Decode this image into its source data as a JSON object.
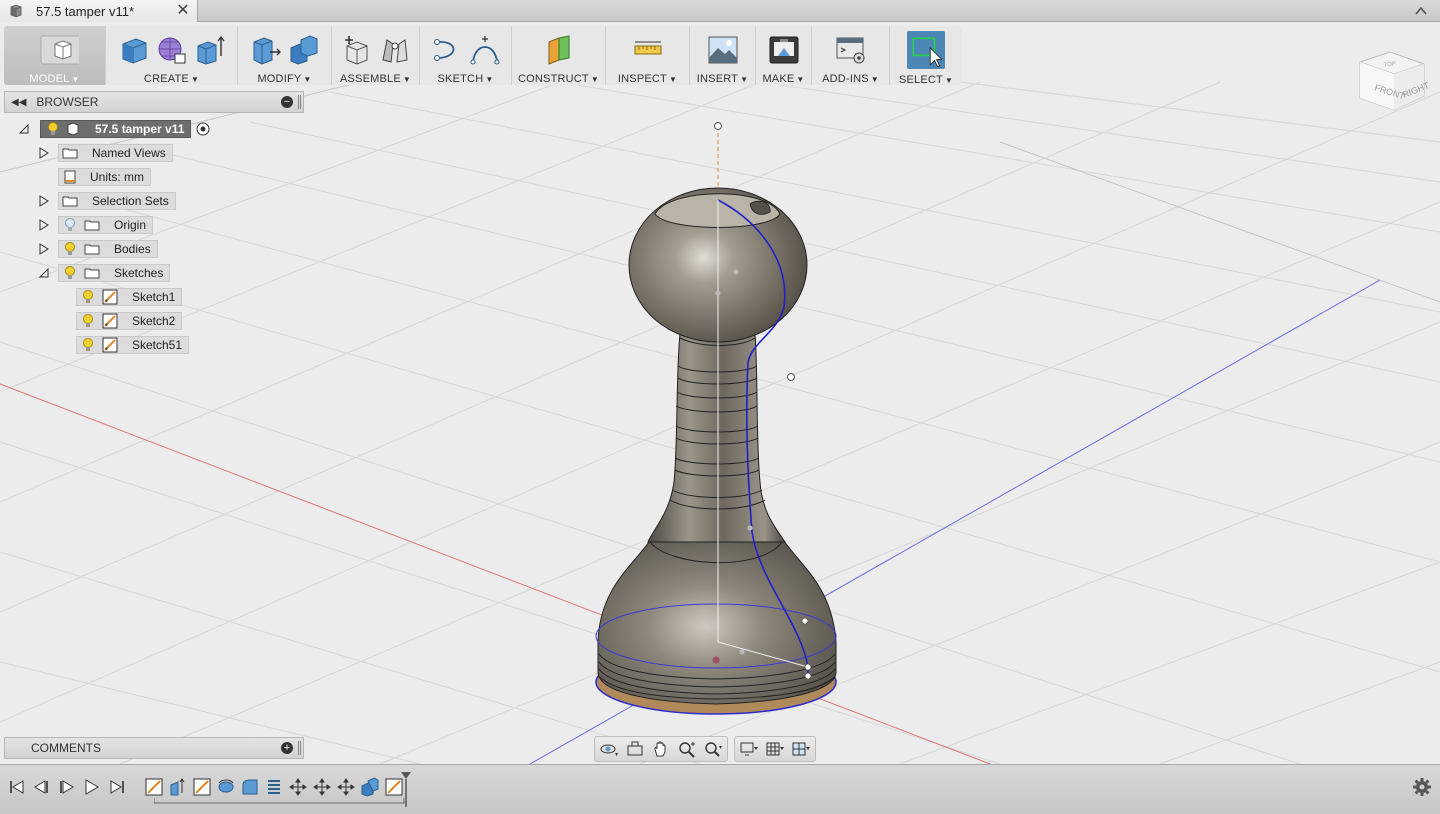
{
  "document": {
    "title": "57.5 tamper v11*",
    "close_glyph": "✕"
  },
  "toolbar": {
    "groups": [
      {
        "id": "model",
        "label": "MODEL",
        "icon": "model-workspace-icon"
      },
      {
        "id": "create",
        "label": "CREATE",
        "icon": "create-box-icon"
      },
      {
        "id": "modify",
        "label": "MODIFY",
        "icon": "press-pull-icon"
      },
      {
        "id": "assemble",
        "label": "ASSEMBLE",
        "icon": "new-component-icon"
      },
      {
        "id": "sketch",
        "label": "SKETCH",
        "icon": "sketch-icon"
      },
      {
        "id": "construct",
        "label": "CONSTRUCT",
        "icon": "plane-icon"
      },
      {
        "id": "inspect",
        "label": "INSPECT",
        "icon": "measure-icon"
      },
      {
        "id": "insert",
        "label": "INSERT",
        "icon": "insert-image-icon"
      },
      {
        "id": "make",
        "label": "MAKE",
        "icon": "3d-print-icon"
      },
      {
        "id": "addins",
        "label": "ADD-INS",
        "icon": "scripts-icon"
      },
      {
        "id": "select",
        "label": "SELECT",
        "icon": "select-window-icon"
      }
    ]
  },
  "viewcube": {
    "top": "TOP",
    "front": "FRONT",
    "right": "RIGHT"
  },
  "browser": {
    "title": "BROWSER",
    "root": "57.5 tamper v11",
    "items": [
      {
        "label": "Named Views"
      },
      {
        "label": "Units: mm"
      },
      {
        "label": "Selection Sets"
      },
      {
        "label": "Origin"
      },
      {
        "label": "Bodies"
      },
      {
        "label": "Sketches"
      },
      {
        "label": "Sketch1"
      },
      {
        "label": "Sketch2"
      },
      {
        "label": "Sketch51"
      }
    ]
  },
  "comments": {
    "title": "COMMENTS"
  },
  "colors": {
    "selectActive": "#4b86b4",
    "sketchLine": "#2a2ad0",
    "axisRed": "#e05050",
    "axisBlue": "#5050e0",
    "axisOrange": "#e08a2a"
  }
}
